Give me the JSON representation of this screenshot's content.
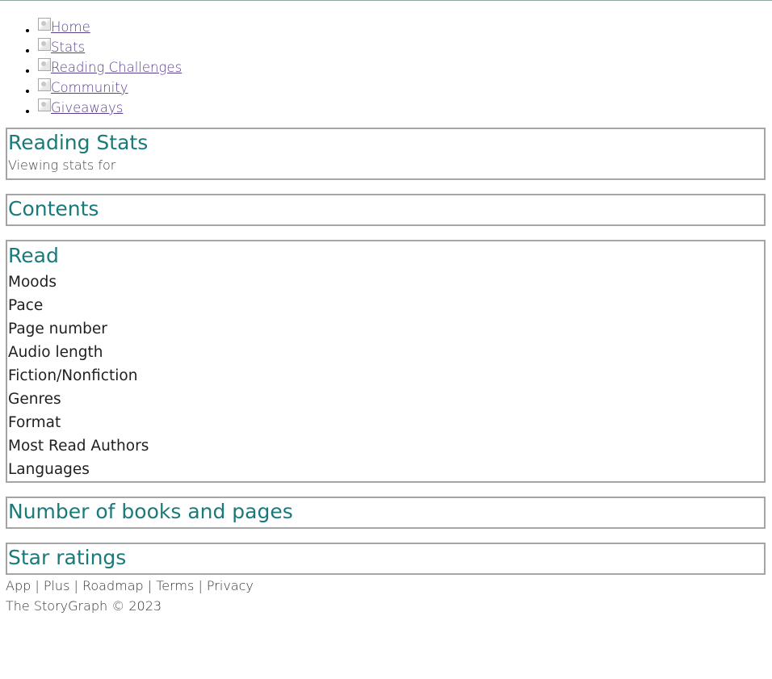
{
  "nav": {
    "items": [
      {
        "label": "Home",
        "icon": "home-icon"
      },
      {
        "label": "Stats",
        "icon": "stats-icon"
      },
      {
        "label": "Reading Challenges",
        "icon": "challenges-icon"
      },
      {
        "label": "Community",
        "icon": "community-icon"
      },
      {
        "label": "Giveaways",
        "icon": "giveaways-icon"
      }
    ]
  },
  "header": {
    "title": "Reading Stats",
    "subtitle": "Viewing stats for"
  },
  "contents": {
    "title": "Contents"
  },
  "read": {
    "title": "Read",
    "items": [
      "Moods",
      "Pace",
      "Page number",
      "Audio length",
      "Fiction/Nonfiction",
      "Genres",
      "Format",
      "Most Read Authors",
      "Languages"
    ]
  },
  "books_pages": {
    "title": "Number of books and pages"
  },
  "star_ratings": {
    "title": "Star ratings"
  },
  "footer": {
    "links": [
      "App",
      "Plus",
      "Roadmap",
      "Terms",
      "Privacy"
    ],
    "separator": " | ",
    "copyright": "The StoryGraph © 2023"
  },
  "colors": {
    "heading": "#1a7a7a",
    "link": "#5a3e8e",
    "border": "#a5a5a5"
  }
}
